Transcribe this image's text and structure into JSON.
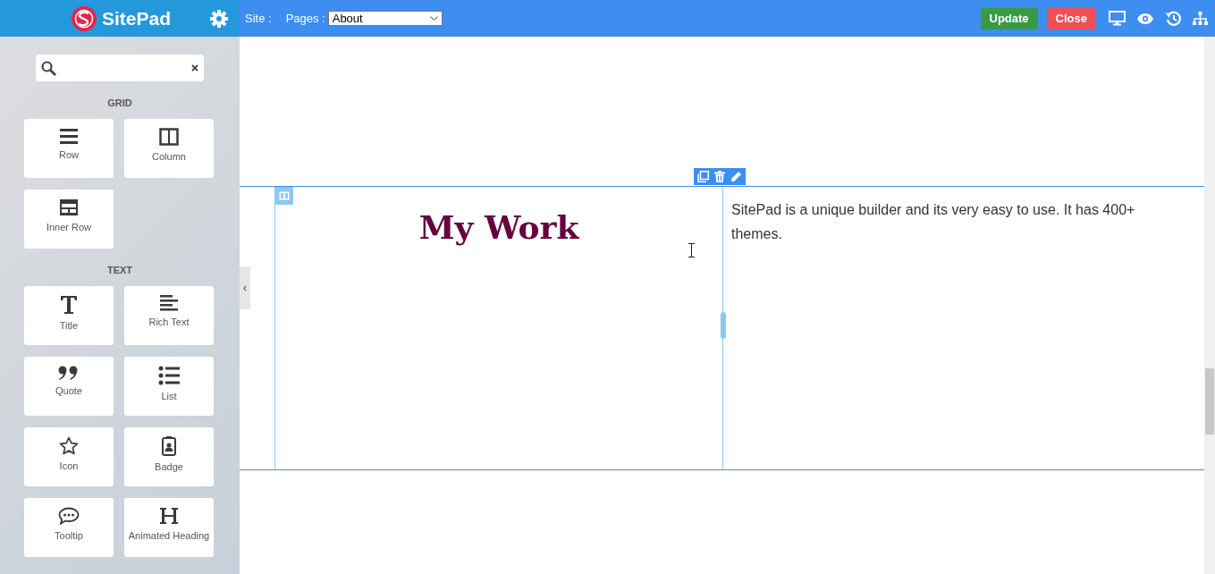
{
  "brand": {
    "name": "SitePad"
  },
  "topbar": {
    "site_label": "Site :",
    "pages_label": "Pages :",
    "page_select": "About",
    "buttons": [
      {
        "label": "Update",
        "kind": "update"
      },
      {
        "label": "Close",
        "kind": "close"
      }
    ],
    "tools": [
      {
        "kind": "desktop"
      },
      {
        "kind": "preview"
      },
      {
        "kind": "history"
      },
      {
        "kind": "sitemap"
      }
    ]
  },
  "sidebar": {
    "sections": [
      {
        "title": "GRID",
        "widgets": [
          {
            "label": "Row",
            "kind": "row"
          },
          {
            "label": "Column",
            "kind": "column"
          },
          {
            "label": "Inner Row",
            "kind": "inner-row"
          }
        ]
      },
      {
        "title": "TEXT",
        "widgets": [
          {
            "label": "Title",
            "kind": "title"
          },
          {
            "label": "Rich Text",
            "kind": "rich-text"
          },
          {
            "label": "Quote",
            "kind": "quote"
          },
          {
            "label": "List",
            "kind": "list"
          },
          {
            "label": "Icon",
            "kind": "icon"
          },
          {
            "label": "Badge",
            "kind": "badge"
          },
          {
            "label": "Tooltip",
            "kind": "tooltip"
          },
          {
            "label": "Animated Heading",
            "kind": "animated-heading"
          }
        ]
      }
    ],
    "collapse": "‹"
  },
  "canvas": {
    "heading": "My Work",
    "paragraph": "SitePad is a unique builder and its very easy to use. It has 400+ themes."
  }
}
